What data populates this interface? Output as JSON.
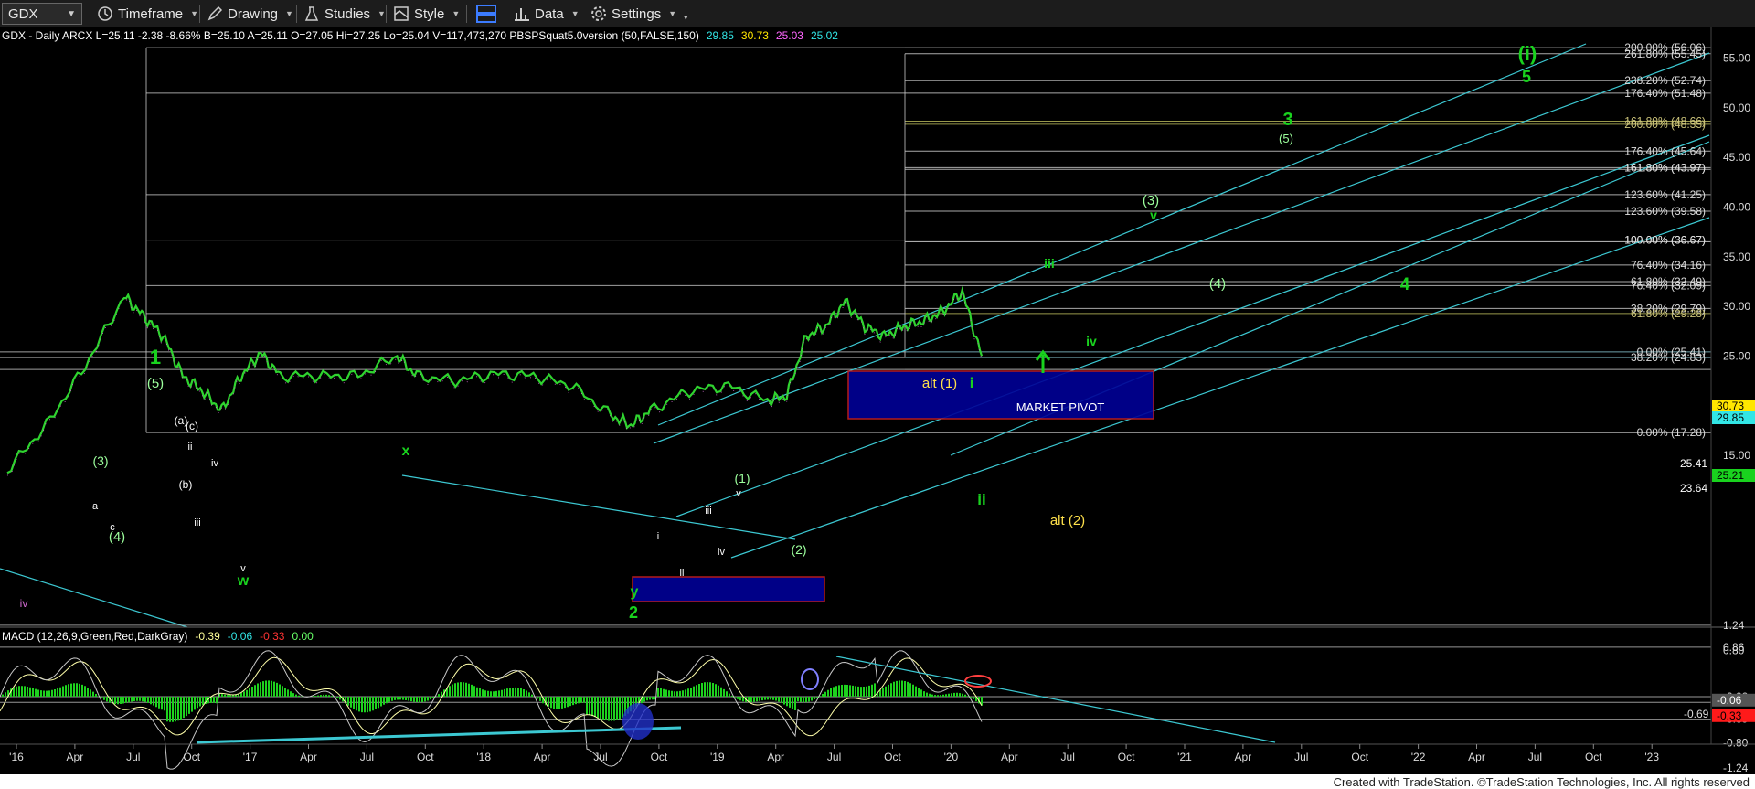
{
  "toolbar": {
    "symbol": "GDX",
    "timeframe": "Timeframe",
    "drawing": "Drawing",
    "studies": "Studies",
    "style": "Style",
    "data": "Data",
    "settings": "Settings"
  },
  "chart_info": {
    "header": "GDX - Daily  ARCX  L=25.11  -2.38  -8.66%  B=25.10  A=25.11  O=27.05  Hi=27.25  Lo=25.04  V=117,473,270  PBSPSquat5.0version (50,FALSE,150)",
    "sq_values": [
      {
        "text": "29.85",
        "color": "#32e6e6"
      },
      {
        "text": "30.73",
        "color": "#ffe600"
      },
      {
        "text": "25.03",
        "color": "#ff66ff"
      },
      {
        "text": "25.02",
        "color": "#32e6e6"
      }
    ],
    "macd_header": "MACD (12,26,9,Green,Red,DarkGray)",
    "macd_values": [
      {
        "text": "-0.39",
        "color": "#ffff99"
      },
      {
        "text": "-0.06",
        "color": "#32e6e6"
      },
      {
        "text": "-0.33",
        "color": "#ff3333"
      },
      {
        "text": "0.00",
        "color": "#66ff66"
      }
    ]
  },
  "colors": {
    "background": "#000000",
    "wave_green": "#19d21e",
    "wave_light": "#9cff9c",
    "alt_yellow": "#ffe14b",
    "channel": "#3cc8d2",
    "box_fill": "#000096",
    "box_border": "#c81e1e",
    "price_line": "#2fd42f",
    "level_line": "#c8c8c8"
  },
  "chart_data": {
    "type": "line",
    "title": "",
    "xlabel": "",
    "ylabel": "",
    "ylim": [
      13,
      60
    ],
    "y_ticks": [
      "15.00",
      "20.00",
      "25.00",
      "30.00",
      "35.00",
      "40.00",
      "45.00",
      "50.00",
      "55.00"
    ],
    "x_ticks": [
      "'16",
      "Apr",
      "Jul",
      "Oct",
      "'17",
      "Apr",
      "Jul",
      "Oct",
      "'18",
      "Apr",
      "Jul",
      "Oct",
      "'19",
      "Apr",
      "Jul",
      "Oct",
      "'20",
      "Apr",
      "Jul",
      "Oct",
      "'21",
      "Apr",
      "Jul",
      "Oct",
      "'22",
      "Apr",
      "Jul",
      "Oct",
      "'23"
    ],
    "series": [
      {
        "x": [
          "2016-01",
          "2016-03",
          "2016-05",
          "2016-07",
          "2016-08",
          "2016-09",
          "2016-10",
          "2016-11",
          "2016-12",
          "2017-01",
          "2017-02",
          "2017-03",
          "2017-05",
          "2017-07",
          "2017-09",
          "2017-10",
          "2017-12",
          "2018-02",
          "2018-04",
          "2018-06",
          "2018-08",
          "2018-09",
          "2018-10",
          "2018-12",
          "2019-02",
          "2019-04",
          "2019-05",
          "2019-06",
          "2019-07",
          "2019-08",
          "2019-09",
          "2019-10",
          "2019-11",
          "2019-12",
          "2020-01",
          "2020-02",
          "2020-03"
        ],
        "y": [
          13.5,
          18,
          24,
          31,
          29,
          27,
          23,
          21.5,
          19.5,
          23,
          25.3,
          23,
          23,
          23,
          25,
          23,
          22.5,
          23.2,
          23,
          22,
          19,
          18,
          19.5,
          21.5,
          22,
          20.5,
          21,
          27,
          28,
          30.5,
          28,
          27,
          28,
          28.5,
          29.5,
          31.5,
          25
        ]
      }
    ],
    "fib_levels": [
      {
        "pct": "200.00%",
        "value": "56.06"
      },
      {
        "pct": "261.80%",
        "value": "55.45"
      },
      {
        "pct": "238.20%",
        "value": "52.74"
      },
      {
        "pct": "176.40%",
        "value": "51.48"
      },
      {
        "pct": "161.80%",
        "value": "48.66"
      },
      {
        "pct": "200.00%",
        "value": "48.35"
      },
      {
        "pct": "176.40%",
        "value": "45.64"
      },
      {
        "pct": "161.80%",
        "value": "43.97"
      },
      {
        "pct": "161.80%",
        "value": "43.97"
      },
      {
        "pct": "123.60%",
        "value": "41.25"
      },
      {
        "pct": "123.60%",
        "value": "39.58"
      },
      {
        "pct": "100.00%",
        "value": "36.67"
      },
      {
        "pct": "100.00%",
        "value": "36.67"
      },
      {
        "pct": "76.40%",
        "value": "34.16"
      },
      {
        "pct": "61.80%",
        "value": "32.49"
      },
      {
        "pct": "76.40%",
        "value": "32.09"
      },
      {
        "pct": "38.20%",
        "value": "29.79"
      },
      {
        "pct": "61.80%",
        "value": "29.28"
      },
      {
        "pct": "0.00%",
        "value": "25.41"
      },
      {
        "pct": "38.20%",
        "value": "24.83"
      },
      {
        "pct": "0.00%",
        "value": "17.28"
      }
    ],
    "price_labels": [
      {
        "text": "30.73",
        "bg": "#ffe600",
        "fg": "#000"
      },
      {
        "text": "29.85",
        "bg": "#32e6e6",
        "fg": "#000"
      },
      {
        "text": "25.21",
        "bg": "#19d21e",
        "fg": "#000"
      }
    ],
    "plain_labels": [
      "25.41",
      "23.64"
    ],
    "wave_labels": [
      "1",
      "(5)",
      "(3)",
      "(4)",
      "(a)",
      "(c)",
      "(b)",
      "ii",
      "iv",
      "iii",
      "a",
      "c",
      "v",
      "iv",
      "w",
      "x",
      "y",
      "2",
      "(1)",
      "(2)",
      "i",
      "ii",
      "iii",
      "iv",
      "v",
      "alt (1)",
      "i",
      "ii",
      "iv",
      "iii",
      "(3)",
      "v",
      "(4)",
      "3",
      "(5)",
      "(i)",
      "5",
      "4",
      "alt (2)"
    ],
    "market_pivot": "MARKET PIVOT",
    "macd": {
      "y_ticks": [
        "1.24",
        "0.86",
        "0.80",
        "-0.00",
        "-0.10",
        "-0.39",
        "-0.80",
        "-1.24"
      ],
      "labels": [
        {
          "text": "-0.06",
          "bg": "#555",
          "fg": "#fff"
        },
        {
          "text": "-0.33",
          "bg": "#ff1a1a",
          "fg": "#000"
        }
      ],
      "overlay_labels": [
        "-0.69"
      ]
    }
  },
  "footer": "Created with TradeStation. ©TradeStation Technologies, Inc. All rights reserved"
}
